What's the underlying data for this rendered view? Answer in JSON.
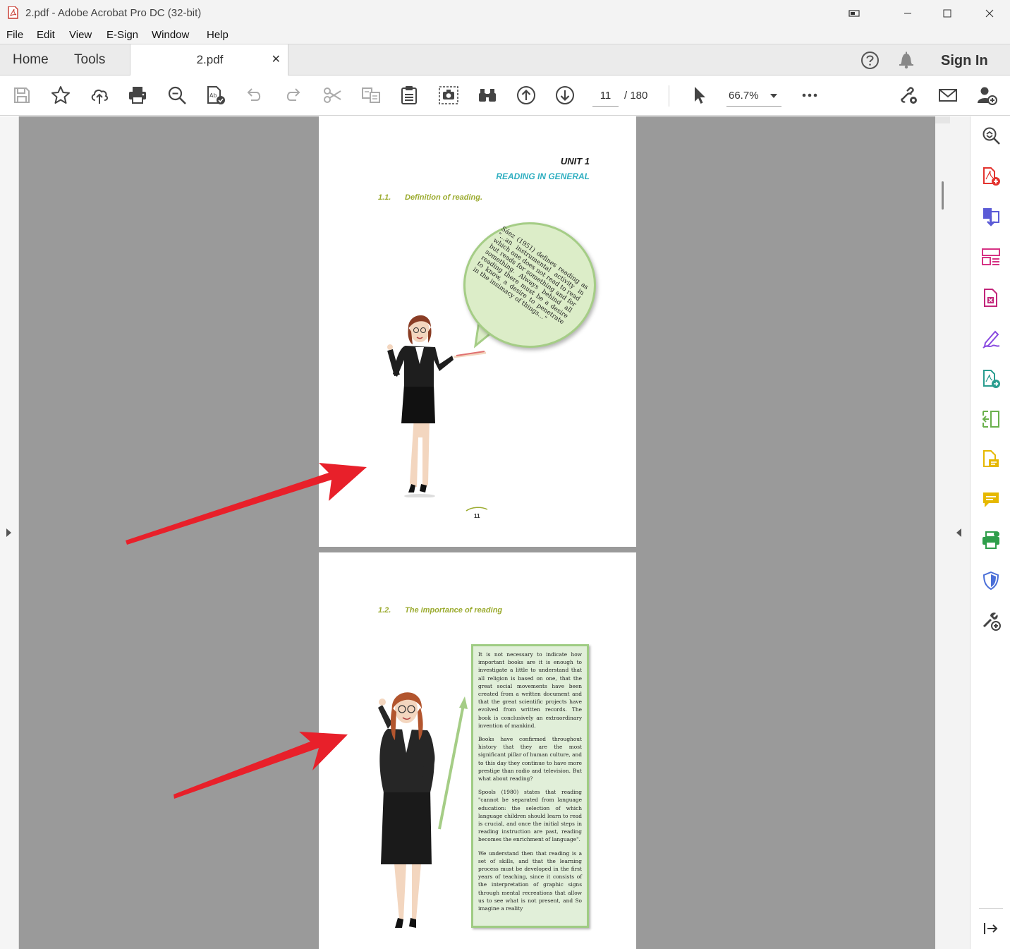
{
  "window": {
    "title": "2.pdf - Adobe Acrobat Pro DC (32-bit)"
  },
  "menu": [
    "File",
    "Edit",
    "View",
    "E-Sign",
    "Window",
    "Help"
  ],
  "tabs": {
    "home": "Home",
    "tools": "Tools",
    "document": "2.pdf",
    "sign_in": "Sign In"
  },
  "toolbar": {
    "current_page": "11",
    "total_pages": "/  180",
    "zoom": "66.7%",
    "icons": [
      "save-icon",
      "bookmark-star-icon",
      "upload-cloud-icon",
      "print-icon",
      "zoom-search-icon",
      "spellcheck-icon",
      "undo-icon",
      "redo-icon",
      "cut-icon",
      "compare-icon",
      "clipboard-icon",
      "snapshot-icon",
      "find-binoculars-icon",
      "page-up-icon",
      "page-down-icon",
      "select-cursor-icon",
      "more-icon",
      "share-link-icon",
      "email-icon",
      "add-user-icon"
    ]
  },
  "page1": {
    "unit": "UNIT 1",
    "unit_subtitle": "READING IN GENERAL",
    "section_number": "1.1.",
    "section_title": "Definition of reading.",
    "bubble_text": "Sáez (1951) defines reading as \"…an instrumental activity in which one does not read to read but reads for something and for something. Always behind all reading there must be a desire to know, a desire to penetrate in the insimacy of things…\"",
    "page_number": "11"
  },
  "page2": {
    "section_number": "1.2.",
    "section_title": "The importance of reading",
    "paragraphs": [
      "It is not necessary to indicate how important books are it is enough to investigate a little to understand that all religion is based on one, that the great social movements have been created from a written document and that the great scientific projects have evolved from written records. The book is conclusively an extraordinary invention of mankind.",
      "Books have confirmed throughout history that they are the most significant pillar of human culture, and to this day they continue to have more prestige than radio and television. But what about reading?",
      "Spools (1980) states that reading \"cannot be separated from language education: the selection of which language children should learn to read is crucial, and once the initial steps in reading instruction are past, reading becomes the enrichment of language\".",
      "We understand then that reading is a set of skills, and that the learning process must be developed in the first years of teaching, since it consists of the interpretation of graphic signs through mental recreations that allow us to see what is not present, and So imagine a reality"
    ]
  },
  "sidebar_tools": [
    "zoom-in-icon",
    "create-pdf-icon",
    "export-pdf-icon",
    "organize-pages-icon",
    "compress-pdf-icon",
    "fill-sign-icon",
    "send-review-icon",
    "scan-ocr-icon",
    "edit-pdf-icon",
    "comment-icon",
    "print-production-icon",
    "protect-icon",
    "more-tools-icon",
    "collapse-panel-icon"
  ],
  "colors": {
    "accent_teal": "#2eaec0",
    "section_olive": "#9bab2f",
    "box_green": "#9fcc83",
    "annotation_red": "#e8202a",
    "canvas_gray": "#9a9a9a"
  }
}
